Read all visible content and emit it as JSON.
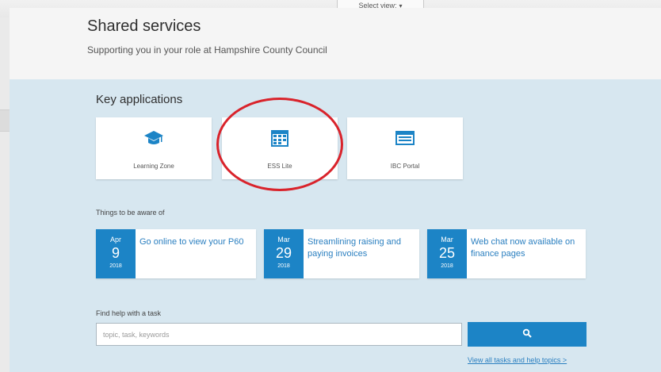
{
  "topbar": {
    "select_view_label": "Select view:"
  },
  "header": {
    "title": "Shared services",
    "subtitle": "Supporting you in your role at Hampshire County Council"
  },
  "key_applications": {
    "heading": "Key applications",
    "apps": [
      {
        "label": "Learning Zone",
        "icon": "graduation-cap-icon"
      },
      {
        "label": "ESS Lite",
        "icon": "calendar-icon"
      },
      {
        "label": "IBC Portal",
        "icon": "browser-window-icon"
      }
    ]
  },
  "things_to_be_aware_of": {
    "heading": "Things to be aware of",
    "items": [
      {
        "month": "Apr",
        "day": "9",
        "year": "2018",
        "text": "Go online to view your P60"
      },
      {
        "month": "Mar",
        "day": "29",
        "year": "2018",
        "text": "Streamlining raising and paying invoices"
      },
      {
        "month": "Mar",
        "day": "25",
        "year": "2018",
        "text": "Web chat now available on finance pages"
      }
    ]
  },
  "find_help": {
    "label": "Find help with a task",
    "search_placeholder": "topic, task, keywords",
    "search_button_icon": "search-icon",
    "view_all_link": "View all tasks and help topics >"
  },
  "colors": {
    "accent_blue": "#1c84c6",
    "panel_background": "#d7e7f0",
    "highlight_circle": "#d9232b"
  }
}
